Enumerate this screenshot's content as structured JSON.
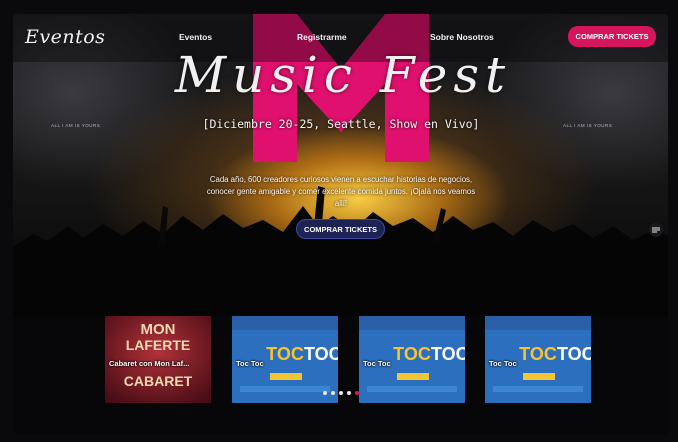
{
  "nav": {
    "logo": "Eventos",
    "links": [
      "Eventos",
      "Registrarme",
      "Sobre Nosotros"
    ],
    "cta": "COMPRAR TICKETS"
  },
  "hero": {
    "title": "Music Fest",
    "subtitle": "[Diciembre 20-25, Seattle, Show en Vivo]",
    "description": "Cada año, 600 creadores curiosos vienen a escuchar historias de negocios, conocer gente amigable y comer excelente comida juntos. ¡Ojalá nos veamos allí!",
    "cta": "COMPRAR TICKETS",
    "side_text": "ALL I AM IS YOURS",
    "side_text_right": "ALL I AM IS YOURS"
  },
  "cards": [
    {
      "label": "Cabaret con Mon Laf...",
      "poster_text": [
        "MON",
        "LAFERTE",
        "CABARET"
      ]
    },
    {
      "label": "Toc Toc",
      "poster_text": [
        "TOC",
        "TOC"
      ]
    },
    {
      "label": "Toc Toc",
      "poster_text": [
        "TOC",
        "TOC"
      ]
    },
    {
      "label": "Toc Toc",
      "poster_text": [
        "TOC",
        "TOC"
      ]
    }
  ],
  "carousel": {
    "count": 5,
    "active": 4
  },
  "colors": {
    "accent_pink": "#d6155f",
    "cta_blue": "#1d2354",
    "dot_inactive": "#e8e8e8"
  }
}
